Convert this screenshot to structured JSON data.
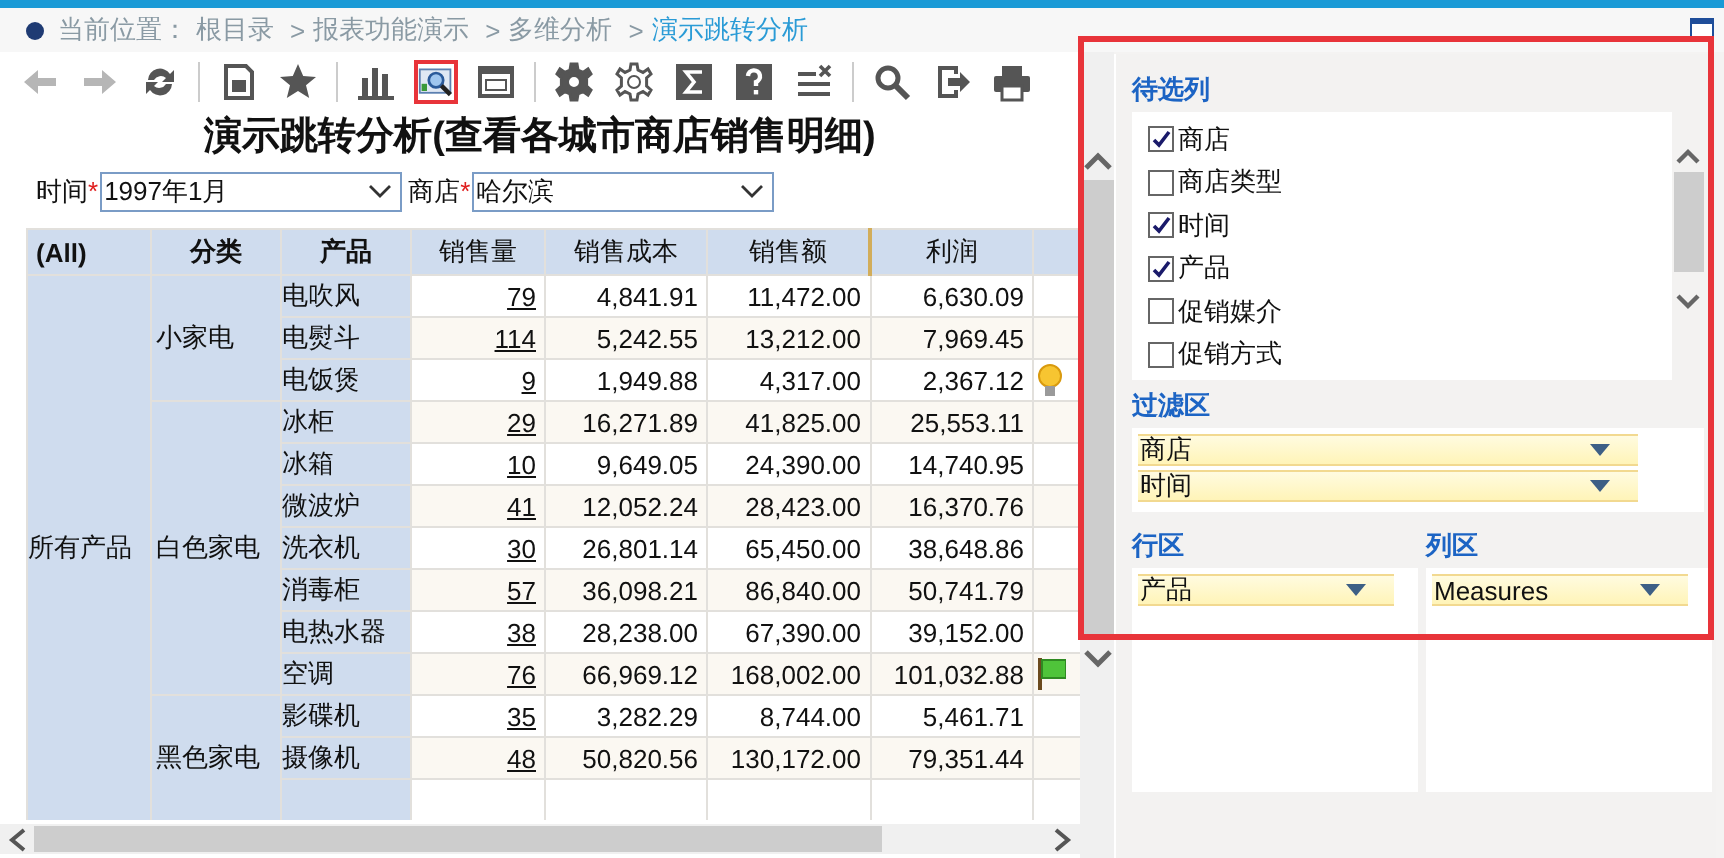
{
  "breadcrumb": {
    "label": "当前位置：",
    "separator": ">",
    "items": [
      "根目录",
      "报表功能演示",
      "多维分析",
      "演示跳转分析"
    ]
  },
  "toolbar": [
    {
      "kind": "back",
      "disabled": true,
      "selected": false
    },
    {
      "kind": "forward",
      "disabled": true,
      "selected": false
    },
    {
      "kind": "refresh",
      "disabled": false,
      "selected": false
    },
    {
      "kind": "sep"
    },
    {
      "kind": "save",
      "disabled": false,
      "selected": false
    },
    {
      "kind": "star",
      "disabled": false,
      "selected": false
    },
    {
      "kind": "sep"
    },
    {
      "kind": "chart",
      "disabled": false,
      "selected": false
    },
    {
      "kind": "view",
      "disabled": false,
      "selected": true
    },
    {
      "kind": "layout",
      "disabled": false,
      "selected": false
    },
    {
      "kind": "sep"
    },
    {
      "kind": "gear",
      "disabled": false,
      "selected": false
    },
    {
      "kind": "gear-outline",
      "disabled": false,
      "selected": false
    },
    {
      "kind": "sigma",
      "disabled": false,
      "selected": false
    },
    {
      "kind": "help",
      "disabled": false,
      "selected": false
    },
    {
      "kind": "clear",
      "disabled": false,
      "selected": false
    },
    {
      "kind": "sep"
    },
    {
      "kind": "search",
      "disabled": false,
      "selected": false
    },
    {
      "kind": "export",
      "disabled": false,
      "selected": false
    },
    {
      "kind": "print",
      "disabled": false,
      "selected": false
    }
  ],
  "report_title": "演示跳转分析(查看各城市商店销售明细)",
  "filters": [
    {
      "label": "时间",
      "required_mark": "*",
      "value": "1997年1月"
    },
    {
      "label": "商店",
      "required_mark": "*",
      "value": "哈尔滨"
    }
  ],
  "table": {
    "columns": [
      "(All)",
      "分类",
      "产品",
      "销售量",
      "销售成本",
      "销售额",
      "利润"
    ],
    "all_label": "所有产品",
    "groups": [
      {
        "category": "小家电",
        "rows": [
          {
            "kind": "plain",
            "product": "电吹风",
            "qty": "79",
            "cost": "4,841.91",
            "sales": "11,472.00",
            "profit": "6,630.09"
          },
          {
            "kind": "plain",
            "product": "电熨斗",
            "qty": "114",
            "cost": "5,242.55",
            "sales": "13,212.00",
            "profit": "7,969.45"
          },
          {
            "kind": "bulb",
            "product": "电饭煲",
            "qty": "9",
            "cost": "1,949.88",
            "sales": "4,317.00",
            "profit": "2,367.12"
          }
        ]
      },
      {
        "category": "白色家电",
        "rows": [
          {
            "kind": "plain",
            "product": "冰柜",
            "qty": "29",
            "cost": "16,271.89",
            "sales": "41,825.00",
            "profit": "25,553.11"
          },
          {
            "kind": "plain",
            "product": "冰箱",
            "qty": "10",
            "cost": "9,649.05",
            "sales": "24,390.00",
            "profit": "14,740.95"
          },
          {
            "kind": "plain",
            "product": "微波炉",
            "qty": "41",
            "cost": "12,052.24",
            "sales": "28,423.00",
            "profit": "16,370.76"
          },
          {
            "kind": "plain",
            "product": "洗衣机",
            "qty": "30",
            "cost": "26,801.14",
            "sales": "65,450.00",
            "profit": "38,648.86"
          },
          {
            "kind": "plain",
            "product": "消毒柜",
            "qty": "57",
            "cost": "36,098.21",
            "sales": "86,840.00",
            "profit": "50,741.79"
          },
          {
            "kind": "plain",
            "product": "电热水器",
            "qty": "38",
            "cost": "28,238.00",
            "sales": "67,390.00",
            "profit": "39,152.00"
          },
          {
            "kind": "flag",
            "product": "空调",
            "qty": "76",
            "cost": "66,969.12",
            "sales": "168,002.00",
            "profit": "101,032.88"
          }
        ]
      },
      {
        "category": "黑色家电",
        "rows": [
          {
            "kind": "plain",
            "product": "影碟机",
            "qty": "35",
            "cost": "3,282.29",
            "sales": "8,744.00",
            "profit": "5,461.71"
          },
          {
            "kind": "plain",
            "product": "摄像机",
            "qty": "48",
            "cost": "50,820.56",
            "sales": "130,172.00",
            "profit": "79,351.44"
          }
        ]
      }
    ]
  },
  "panel": {
    "candidates": {
      "title": "待选列",
      "items": [
        {
          "label": "商店",
          "checked": true
        },
        {
          "label": "商店类型",
          "checked": false
        },
        {
          "label": "时间",
          "checked": true
        },
        {
          "label": "产品",
          "checked": true
        },
        {
          "label": "促销媒介",
          "checked": false
        },
        {
          "label": "促销方式",
          "checked": false
        }
      ]
    },
    "filter_area": {
      "title": "过滤区",
      "items": [
        "商店",
        "时间"
      ]
    },
    "row_area": {
      "title": "行区",
      "items": [
        "产品"
      ]
    },
    "column_area": {
      "title": "列区",
      "items": [
        "Measures"
      ]
    }
  }
}
